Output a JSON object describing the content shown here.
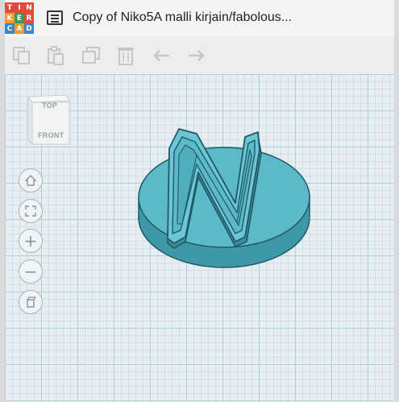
{
  "app": {
    "logo_letters": [
      "T",
      "I",
      "N",
      "K",
      "E",
      "R",
      "C",
      "A",
      "D"
    ],
    "logo_colors": [
      "#e24a3b",
      "#e24a3b",
      "#e24a3b",
      "#f19a2e",
      "#2e9e5b",
      "#e24a3b",
      "#3b86c7",
      "#f19a2e",
      "#3b86c7"
    ],
    "menu_icon": "list-icon",
    "title": "Copy of Niko5A malli kirjain/fabolous..."
  },
  "toolbar": {
    "items": [
      {
        "icon": "copy-icon"
      },
      {
        "icon": "paste-icon"
      },
      {
        "icon": "duplicate-icon"
      },
      {
        "icon": "delete-icon"
      },
      {
        "icon": "undo-icon"
      },
      {
        "icon": "redo-icon"
      }
    ]
  },
  "viewcube": {
    "top_label": "TOP",
    "front_label": "FRONT"
  },
  "view_controls": [
    {
      "icon": "home-icon"
    },
    {
      "icon": "fit-view-icon"
    },
    {
      "icon": "zoom-in-icon",
      "glyph": "+"
    },
    {
      "icon": "zoom-out-icon",
      "glyph": "−"
    },
    {
      "icon": "perspective-icon"
    }
  ],
  "colors": {
    "model_fill": "#5cb9ca",
    "model_edge": "#1f5a66",
    "grid_major": "#b5ccd8"
  }
}
